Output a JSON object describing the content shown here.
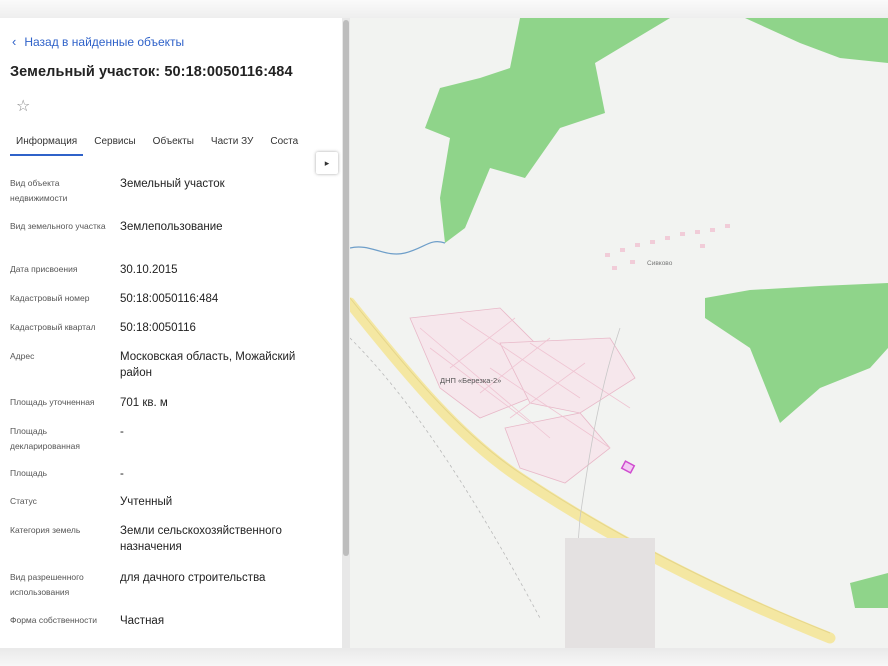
{
  "panel": {
    "back_label": "Назад в найденные объекты",
    "title": "Земельный участок: 50:18:0050116:484",
    "tabs": [
      {
        "label": "Информация",
        "active": true
      },
      {
        "label": "Сервисы",
        "active": false
      },
      {
        "label": "Объекты",
        "active": false
      },
      {
        "label": "Части ЗУ",
        "active": false
      },
      {
        "label": "Соста",
        "active": false
      }
    ],
    "next_arrow": "▸",
    "rows": [
      {
        "label": "Вид объекта недвижимости",
        "value": "Земельный участок"
      },
      {
        "label": "Вид земельного участка",
        "value": "Землепользование"
      },
      {
        "label": "Дата присвоения",
        "value": "30.10.2015"
      },
      {
        "label": "Кадастровый номер",
        "value": "50:18:0050116:484"
      },
      {
        "label": "Кадастровый квартал",
        "value": "50:18:0050116"
      },
      {
        "label": "Адрес",
        "value": "Московская область, Можайский район"
      },
      {
        "label": "Площадь уточненная",
        "value": "701 кв. м"
      },
      {
        "label": "Площадь декларированная",
        "value": "-"
      },
      {
        "label": "Площадь",
        "value": "-"
      },
      {
        "label": "Статус",
        "value": "Учтенный"
      },
      {
        "label": "Категория земель",
        "value": "Земли сельскохозяйственного назначения"
      },
      {
        "label": "Вид разрешенного использования",
        "value": "для дачного строительства"
      },
      {
        "label": "Форма собственности",
        "value": "Частная"
      }
    ]
  },
  "map": {
    "labels": {
      "settlement": "ДНП «Березка-2»",
      "village": "Сивково"
    },
    "colors": {
      "forest": "#8fd48a",
      "road": "#f4e7a2",
      "parcel": "#cf4ccf",
      "background": "#f2f3f1"
    }
  }
}
